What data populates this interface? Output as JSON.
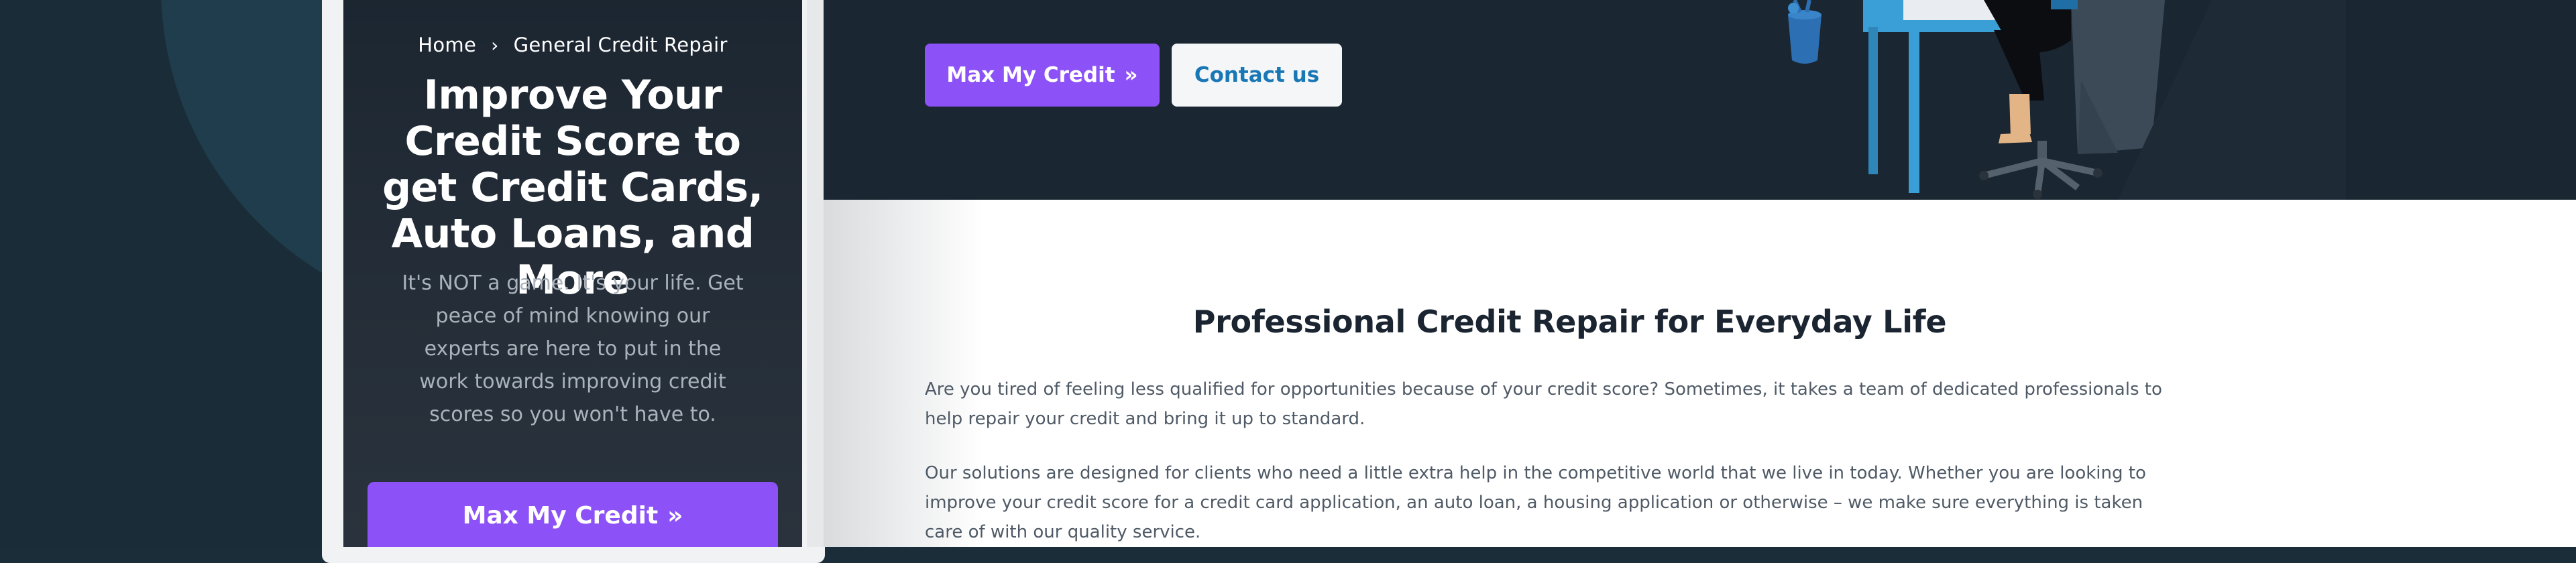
{
  "mobile": {
    "breadcrumb": {
      "home": "Home",
      "current": "General Credit Repair"
    },
    "hero_title": "Improve Your Credit Score to get Credit Cards, Auto Loans, and More",
    "hero_description": "It's NOT a game. It's your life. Get peace of mind knowing our experts are here to put in the work towards improving credit scores so you won't have to.",
    "cta_label": "Max My Credit"
  },
  "hero": {
    "primary_button": "Max My Credit",
    "secondary_button": "Contact us"
  },
  "section": {
    "title": "Professional Credit Repair for Everyday Life",
    "paragraph_1": "Are you tired of feeling less qualified for opportunities because of your credit score? Sometimes, it takes a team of dedicated professionals to help repair your credit and bring it up to standard.",
    "paragraph_2": "Our solutions are designed for clients who need a little extra help in the competitive world that we live in today. Whether you are looking to improve your credit score for a credit card application, an auto loan, a housing application or otherwise – we make sure everything is taken care of with our quality service."
  },
  "icons": [
    "chevron-right-icon",
    "double-chevron-right-icon",
    "desk-illustration"
  ],
  "colors": {
    "accent": "#8d52f7",
    "link": "#1a77b6",
    "dark": "#1a2631"
  }
}
